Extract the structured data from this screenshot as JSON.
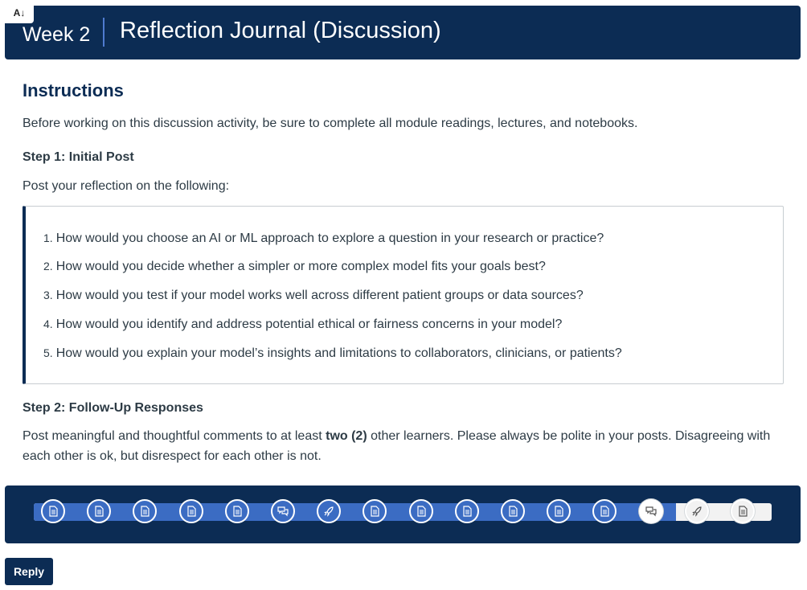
{
  "header": {
    "week": "Week 2",
    "title": "Reflection Journal (Discussion)",
    "a11y_badge": "A↓"
  },
  "instructions": {
    "heading": "Instructions",
    "intro": "Before working on this discussion activity, be sure to complete all module readings, lectures, and notebooks."
  },
  "step1": {
    "heading": "Step 1: Initial Post",
    "intro": "Post your reflection on the following:",
    "questions": [
      {
        "num": "1.",
        "text": "How would you choose an AI or ML approach to explore a question in your research or practice?"
      },
      {
        "num": "2.",
        "text": "How would you decide whether a simpler or more complex model fits your goals best?"
      },
      {
        "num": "3.",
        "text": "How would you test if your model works well across different patient groups or data sources?"
      },
      {
        "num": "4.",
        "text": "How would you identify and address potential ethical or fairness concerns in your model?"
      },
      {
        "num": "5.",
        "text": "How would you explain your model’s insights and limitations to collaborators, clinicians, or patients?"
      }
    ]
  },
  "step2": {
    "heading": "Step 2: Follow-Up Responses",
    "body_before": "Post meaningful and thoughtful comments to at least ",
    "body_bold": "two (2)",
    "body_after": " other learners. Please always be polite in your posts. Disagreeing with each other is ok, but disrespect for each other is not."
  },
  "progress": {
    "completed_fraction": 0.87,
    "steps": [
      {
        "icon": "page-icon",
        "state": "done"
      },
      {
        "icon": "page-icon",
        "state": "done"
      },
      {
        "icon": "page-icon",
        "state": "done"
      },
      {
        "icon": "page-icon",
        "state": "done"
      },
      {
        "icon": "page-icon",
        "state": "done"
      },
      {
        "icon": "discussion-icon",
        "state": "done"
      },
      {
        "icon": "rocket-icon",
        "state": "done"
      },
      {
        "icon": "page-icon",
        "state": "done"
      },
      {
        "icon": "page-icon",
        "state": "done"
      },
      {
        "icon": "page-icon",
        "state": "done"
      },
      {
        "icon": "page-icon",
        "state": "done"
      },
      {
        "icon": "page-icon",
        "state": "done"
      },
      {
        "icon": "page-icon",
        "state": "done"
      },
      {
        "icon": "discussion-icon",
        "state": "current"
      },
      {
        "icon": "rocket-icon",
        "state": "todo"
      },
      {
        "icon": "page-icon",
        "state": "todo"
      }
    ]
  },
  "reply": {
    "label": "Reply"
  },
  "colors": {
    "navy": "#0c2c54",
    "progress_blue": "#3b6cc3",
    "text": "#2d3b45"
  }
}
